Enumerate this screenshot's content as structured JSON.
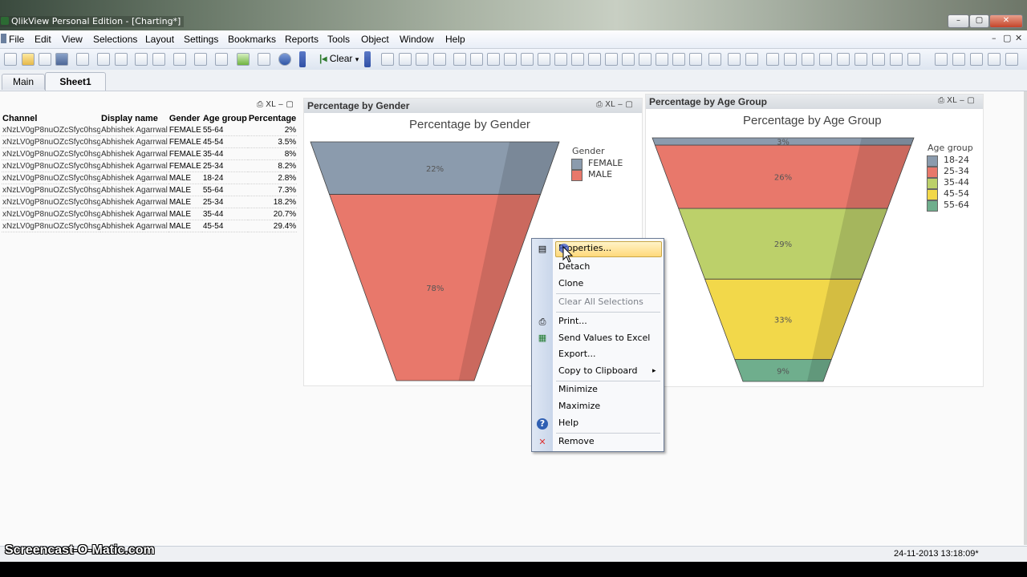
{
  "window": {
    "title": "QlikView Personal Edition - [Charting*]",
    "min_glyph": "–",
    "max_glyph": "▢",
    "close_glyph": "✕",
    "mdi_min": "–",
    "mdi_max": "▢",
    "mdi_close": "✕"
  },
  "menu": [
    "File",
    "Edit",
    "View",
    "Selections",
    "Layout",
    "Settings",
    "Bookmarks",
    "Reports",
    "Tools",
    "Object",
    "Window",
    "Help"
  ],
  "toolbar": {
    "clear_label": "Clear",
    "clear_caret": "▾"
  },
  "tabs": [
    {
      "label": "Main"
    },
    {
      "label": "Sheet1",
      "active": true
    }
  ],
  "table": {
    "caption_icons": "⎙ XL ‒ ▢",
    "columns": [
      "Channel",
      "Display name",
      "Gender",
      "Age group",
      "Percentage"
    ],
    "rows": [
      [
        "xNzLV0gP8nuOZcSfyc0hsg",
        "Abhishek Agarrwal",
        "FEMALE",
        "55-64",
        "2%"
      ],
      [
        "xNzLV0gP8nuOZcSfyc0hsg",
        "Abhishek Agarrwal",
        "FEMALE",
        "45-54",
        "3.5%"
      ],
      [
        "xNzLV0gP8nuOZcSfyc0hsg",
        "Abhishek Agarrwal",
        "FEMALE",
        "35-44",
        "8%"
      ],
      [
        "xNzLV0gP8nuOZcSfyc0hsg",
        "Abhishek Agarrwal",
        "FEMALE",
        "25-34",
        "8.2%"
      ],
      [
        "xNzLV0gP8nuOZcSfyc0hsg",
        "Abhishek Agarrwal",
        "MALE",
        "18-24",
        "2.8%"
      ],
      [
        "xNzLV0gP8nuOZcSfyc0hsg",
        "Abhishek Agarrwal",
        "MALE",
        "55-64",
        "7.3%"
      ],
      [
        "xNzLV0gP8nuOZcSfyc0hsg",
        "Abhishek Agarrwal",
        "MALE",
        "25-34",
        "18.2%"
      ],
      [
        "xNzLV0gP8nuOZcSfyc0hsg",
        "Abhishek Agarrwal",
        "MALE",
        "35-44",
        "20.7%"
      ],
      [
        "xNzLV0gP8nuOZcSfyc0hsg",
        "Abhishek Agarrwal",
        "MALE",
        "45-54",
        "29.4%"
      ]
    ]
  },
  "gender_box": {
    "caption": "Percentage by Gender",
    "icons": "⎙ XL ‒ ▢",
    "chart_title": "Percentage by Gender",
    "legend_title": "Gender"
  },
  "age_box": {
    "caption": "Percentage by Age Group",
    "icons": "⎙ XL ‒ ▢",
    "chart_title": "Percentage by Age Group",
    "legend_title": "Age group"
  },
  "chart_data": [
    {
      "type": "funnel",
      "title": "Percentage by Gender",
      "legend_title": "Gender",
      "series": [
        {
          "name": "FEMALE",
          "value": 22,
          "label": "22%",
          "color": "#8b9bad"
        },
        {
          "name": "MALE",
          "value": 78,
          "label": "78%",
          "color": "#e8786b"
        }
      ]
    },
    {
      "type": "funnel",
      "title": "Percentage by Age Group",
      "legend_title": "Age group",
      "series": [
        {
          "name": "18-24",
          "value": 3,
          "label": "3%",
          "color": "#8b9bad"
        },
        {
          "name": "25-34",
          "value": 26,
          "label": "26%",
          "color": "#e8786b"
        },
        {
          "name": "35-44",
          "value": 29,
          "label": "29%",
          "color": "#bcd06a"
        },
        {
          "name": "45-54",
          "value": 33,
          "label": "33%",
          "color": "#f2d84a"
        },
        {
          "name": "55-64",
          "value": 9,
          "label": "9%",
          "color": "#6fae8d"
        }
      ]
    }
  ],
  "context_menu": {
    "items": [
      "Properties...",
      "Detach",
      "Clone",
      "Clear All Selections",
      "Print...",
      "Send Values to Excel",
      "Export...",
      "Copy to Clipboard",
      "Minimize",
      "Maximize",
      "Help",
      "Remove"
    ],
    "submenu_arrow": "▸"
  },
  "status": {
    "watermark": "Screencast-O-Matic.com",
    "datetime": "24-11-2013 13:18:09*"
  }
}
